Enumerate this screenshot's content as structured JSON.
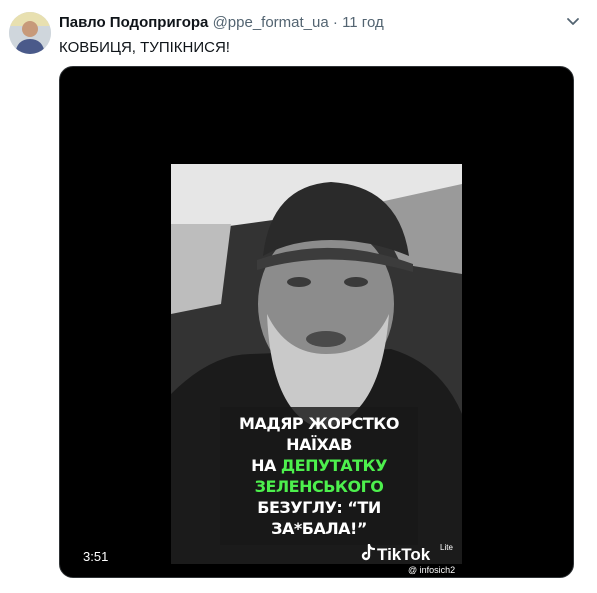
{
  "tweet": {
    "author_name": "Павло Подопригора",
    "author_handle": "@ppe_format_ua",
    "separator": "·",
    "time": "11 год",
    "text": "КОВБИЦЯ, ТУПІКНИСЯ!"
  },
  "video": {
    "caption_line1": "МАДЯР ЖОРСТКО НАЇХАВ",
    "caption_line2_prefix": "НА ",
    "caption_line2_highlight": "ДЕПУТАТКУ ЗЕЛЕНСЬКОГО",
    "caption_line3": "БЕЗУГЛУ: “ТИ ЗА*БАЛА!”",
    "duration": "3:51",
    "watermark": "TikTok",
    "watermark_suffix": "Lite",
    "watermark_handle": "@ infosich2"
  },
  "colors": {
    "highlight": "#4df04d",
    "text_primary": "#0f1419",
    "text_secondary": "#536471"
  }
}
